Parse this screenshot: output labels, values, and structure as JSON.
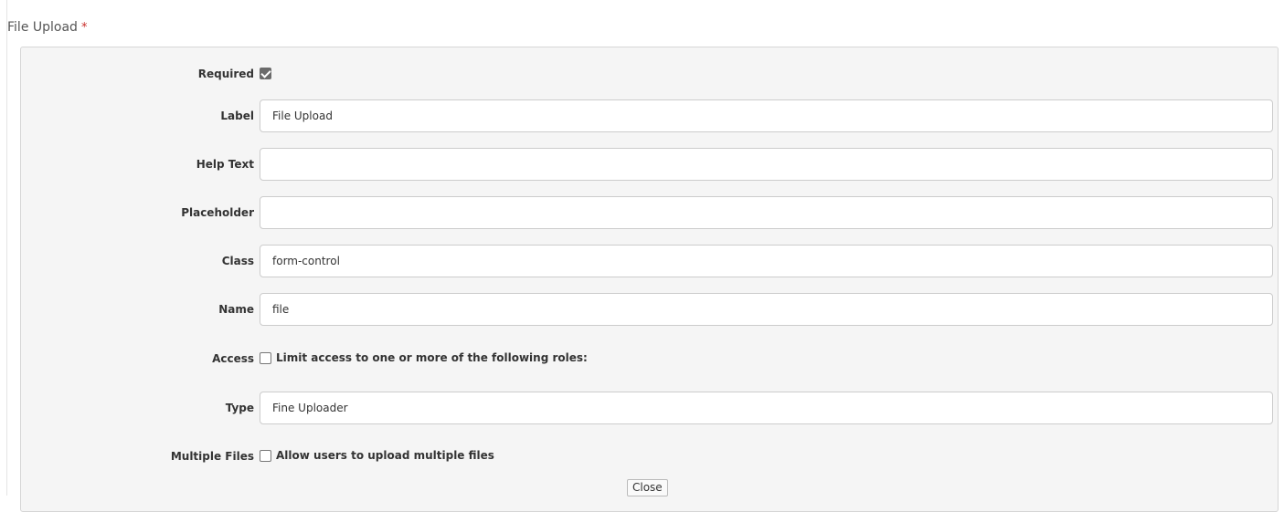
{
  "field": {
    "title": "File Upload",
    "required_marker": "*"
  },
  "form": {
    "required": {
      "label": "Required",
      "checked": true
    },
    "label_field": {
      "label": "Label",
      "value": "File Upload",
      "placeholder": ""
    },
    "help_text": {
      "label": "Help Text",
      "value": "",
      "placeholder": ""
    },
    "placeholder_field": {
      "label": "Placeholder",
      "value": "",
      "placeholder": ""
    },
    "class_field": {
      "label": "Class",
      "value": "form-control",
      "placeholder": ""
    },
    "name_field": {
      "label": "Name",
      "value": "file",
      "placeholder": ""
    },
    "access": {
      "label": "Access",
      "checkbox_text": "Limit access to one or more of the following roles:",
      "checked": false
    },
    "type_field": {
      "label": "Type",
      "value": "Fine Uploader",
      "placeholder": ""
    },
    "multiple_files": {
      "label": "Multiple Files",
      "checkbox_text": "Allow users to upload multiple files",
      "checked": false
    },
    "close_label": "Close"
  },
  "colors": {
    "panel_bg": "#f5f5f5",
    "required_marker": "#c9302c",
    "checkbox_checked": "#6b6b6b"
  }
}
